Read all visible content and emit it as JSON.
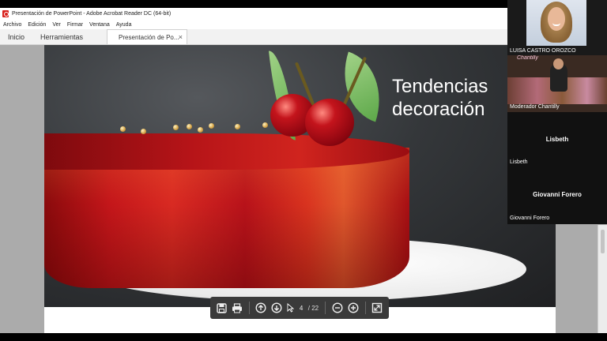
{
  "window": {
    "title": "Presentación de PowerPoint - Adobe Acrobat Reader DC (64-bit)",
    "app_icon": "acrobat-reader-icon"
  },
  "menu": {
    "items": [
      "Archivo",
      "Edición",
      "Ver",
      "Firmar",
      "Ventana",
      "Ayuda"
    ]
  },
  "tabs": {
    "home": "Inicio",
    "tools": "Herramientas",
    "document": "Presentación de Po...",
    "close_glyph": "×"
  },
  "slide": {
    "title_line1": "Tendencias",
    "title_line2": "decoración"
  },
  "toolbar": {
    "current_page": "4",
    "total_pages": "/ 22",
    "icons": [
      "save-icon",
      "print-icon",
      "page-up-icon",
      "page-down-icon",
      "cursor-icon",
      "zoom-out-icon",
      "zoom-in-icon",
      "fit-page-icon"
    ]
  },
  "participants": [
    {
      "name": "LUISA CASTRO OROZCO",
      "has_video": true
    },
    {
      "name": "Moderador Chantilly",
      "has_video": true,
      "sign_text": "Chantilly"
    },
    {
      "name": "Lisbeth",
      "has_video": false
    },
    {
      "name": "Giovanni Forero",
      "has_video": false
    }
  ],
  "colors": {
    "acrobat_red": "#d8201c",
    "toolbar_bg": "#3a3a3a",
    "cake_red": "#c4161a"
  }
}
